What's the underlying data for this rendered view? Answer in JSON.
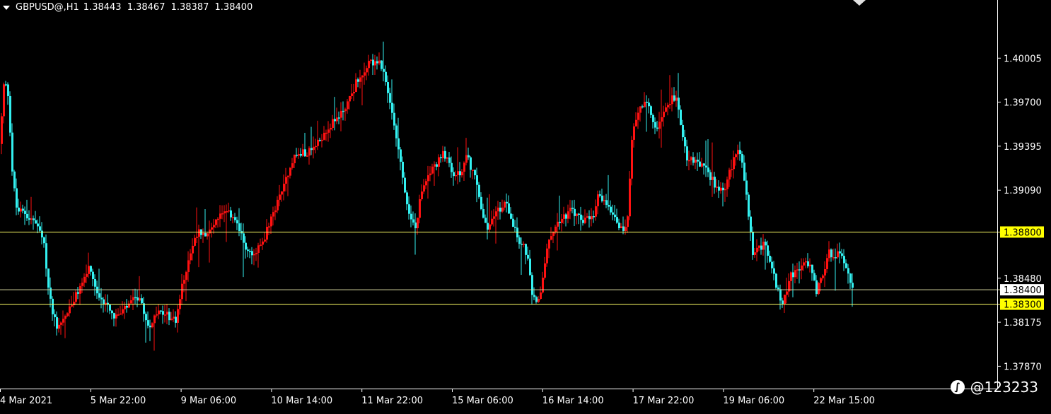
{
  "header": {
    "symbol": "GBPUSD@,H1",
    "open": "1.38443",
    "high": "1.38467",
    "low": "1.38387",
    "close": "1.38400"
  },
  "watermark": "@123233",
  "colors": {
    "background": "#000000",
    "bull": "#ff1111",
    "bear": "#33f0f0",
    "level_line": "#ffff66",
    "price_line": "#d8d8a0",
    "label_bg": "#ffff00",
    "price_label_bg": "#ffffff",
    "axis_text": "#ffffff"
  },
  "chart_data": {
    "type": "candlestick",
    "symbol": "GBPUSD",
    "timeframe": "H1",
    "ylim": [
      1.3773,
      1.4031
    ],
    "y_ticks": [
      "1.40005",
      "1.39700",
      "1.39395",
      "1.39090",
      "1.38480",
      "1.38175",
      "1.37870"
    ],
    "x_ticks": [
      "4 Mar 2021",
      "5 Mar 22:00",
      "9 Mar 06:00",
      "10 Mar 14:00",
      "11 Mar 22:00",
      "15 Mar 06:00",
      "16 Mar 14:00",
      "17 Mar 22:00",
      "19 Mar 06:00",
      "22 Mar 15:00"
    ],
    "levels": [
      {
        "label": "1.38800",
        "value": 1.388
      },
      {
        "label": "1.38300",
        "value": 1.383
      }
    ],
    "current_price": {
      "label": "1.38400",
      "value": 1.384
    },
    "anchors": [
      {
        "x": 0,
        "y": 1.3941
      },
      {
        "x": 6,
        "y": 1.3985
      },
      {
        "x": 12,
        "y": 1.3975
      },
      {
        "x": 18,
        "y": 1.3918
      },
      {
        "x": 24,
        "y": 1.3895
      },
      {
        "x": 36,
        "y": 1.3893
      },
      {
        "x": 52,
        "y": 1.3885
      },
      {
        "x": 62,
        "y": 1.3872
      },
      {
        "x": 70,
        "y": 1.3835
      },
      {
        "x": 80,
        "y": 1.3815
      },
      {
        "x": 90,
        "y": 1.382
      },
      {
        "x": 100,
        "y": 1.3828
      },
      {
        "x": 114,
        "y": 1.3842
      },
      {
        "x": 125,
        "y": 1.3855
      },
      {
        "x": 140,
        "y": 1.3832
      },
      {
        "x": 152,
        "y": 1.3832
      },
      {
        "x": 160,
        "y": 1.3822
      },
      {
        "x": 168,
        "y": 1.3822
      },
      {
        "x": 180,
        "y": 1.3828
      },
      {
        "x": 195,
        "y": 1.3835
      },
      {
        "x": 210,
        "y": 1.3815
      },
      {
        "x": 225,
        "y": 1.3824
      },
      {
        "x": 238,
        "y": 1.3822
      },
      {
        "x": 248,
        "y": 1.3818
      },
      {
        "x": 256,
        "y": 1.3838
      },
      {
        "x": 268,
        "y": 1.3865
      },
      {
        "x": 280,
        "y": 1.388
      },
      {
        "x": 295,
        "y": 1.388
      },
      {
        "x": 310,
        "y": 1.3892
      },
      {
        "x": 330,
        "y": 1.3892
      },
      {
        "x": 345,
        "y": 1.3872
      },
      {
        "x": 358,
        "y": 1.3862
      },
      {
        "x": 370,
        "y": 1.3872
      },
      {
        "x": 385,
        "y": 1.389
      },
      {
        "x": 400,
        "y": 1.3912
      },
      {
        "x": 415,
        "y": 1.3932
      },
      {
        "x": 430,
        "y": 1.3935
      },
      {
        "x": 445,
        "y": 1.3938
      },
      {
        "x": 460,
        "y": 1.395
      },
      {
        "x": 475,
        "y": 1.3958
      },
      {
        "x": 490,
        "y": 1.3968
      },
      {
        "x": 505,
        "y": 1.3985
      },
      {
        "x": 515,
        "y": 1.3992
      },
      {
        "x": 525,
        "y": 1.3998
      },
      {
        "x": 535,
        "y": 1.3998
      },
      {
        "x": 545,
        "y": 1.3985
      },
      {
        "x": 555,
        "y": 1.396
      },
      {
        "x": 563,
        "y": 1.3942
      },
      {
        "x": 572,
        "y": 1.3908
      },
      {
        "x": 580,
        "y": 1.389
      },
      {
        "x": 588,
        "y": 1.3883
      },
      {
        "x": 595,
        "y": 1.3905
      },
      {
        "x": 605,
        "y": 1.3922
      },
      {
        "x": 615,
        "y": 1.3925
      },
      {
        "x": 628,
        "y": 1.3935
      },
      {
        "x": 640,
        "y": 1.392
      },
      {
        "x": 650,
        "y": 1.392
      },
      {
        "x": 660,
        "y": 1.3932
      },
      {
        "x": 672,
        "y": 1.3918
      },
      {
        "x": 682,
        "y": 1.3892
      },
      {
        "x": 688,
        "y": 1.3882
      },
      {
        "x": 700,
        "y": 1.3892
      },
      {
        "x": 715,
        "y": 1.39
      },
      {
        "x": 722,
        "y": 1.3893
      },
      {
        "x": 730,
        "y": 1.3878
      },
      {
        "x": 745,
        "y": 1.3865
      },
      {
        "x": 752,
        "y": 1.3838
      },
      {
        "x": 758,
        "y": 1.3828
      },
      {
        "x": 765,
        "y": 1.384
      },
      {
        "x": 772,
        "y": 1.3865
      },
      {
        "x": 782,
        "y": 1.3882
      },
      {
        "x": 795,
        "y": 1.389
      },
      {
        "x": 808,
        "y": 1.3895
      },
      {
        "x": 818,
        "y": 1.389
      },
      {
        "x": 828,
        "y": 1.3888
      },
      {
        "x": 838,
        "y": 1.3888
      },
      {
        "x": 846,
        "y": 1.3905
      },
      {
        "x": 858,
        "y": 1.39
      },
      {
        "x": 868,
        "y": 1.3893
      },
      {
        "x": 880,
        "y": 1.388
      },
      {
        "x": 888,
        "y": 1.389
      },
      {
        "x": 893,
        "y": 1.394
      },
      {
        "x": 900,
        "y": 1.3962
      },
      {
        "x": 912,
        "y": 1.3972
      },
      {
        "x": 922,
        "y": 1.3958
      },
      {
        "x": 930,
        "y": 1.395
      },
      {
        "x": 940,
        "y": 1.3968
      },
      {
        "x": 950,
        "y": 1.3972
      },
      {
        "x": 958,
        "y": 1.397
      },
      {
        "x": 965,
        "y": 1.395
      },
      {
        "x": 972,
        "y": 1.393
      },
      {
        "x": 985,
        "y": 1.3928
      },
      {
        "x": 995,
        "y": 1.3925
      },
      {
        "x": 1005,
        "y": 1.3918
      },
      {
        "x": 1015,
        "y": 1.391
      },
      {
        "x": 1025,
        "y": 1.3912
      },
      {
        "x": 1035,
        "y": 1.3925
      },
      {
        "x": 1042,
        "y": 1.394
      },
      {
        "x": 1050,
        "y": 1.3925
      },
      {
        "x": 1058,
        "y": 1.3895
      },
      {
        "x": 1065,
        "y": 1.3862
      },
      {
        "x": 1072,
        "y": 1.3868
      },
      {
        "x": 1080,
        "y": 1.3872
      },
      {
        "x": 1090,
        "y": 1.3858
      },
      {
        "x": 1100,
        "y": 1.3838
      },
      {
        "x": 1108,
        "y": 1.383
      },
      {
        "x": 1115,
        "y": 1.3848
      },
      {
        "x": 1125,
        "y": 1.3853
      },
      {
        "x": 1135,
        "y": 1.3858
      },
      {
        "x": 1145,
        "y": 1.3858
      },
      {
        "x": 1155,
        "y": 1.3838
      },
      {
        "x": 1162,
        "y": 1.385
      },
      {
        "x": 1172,
        "y": 1.3865
      },
      {
        "x": 1185,
        "y": 1.3865
      },
      {
        "x": 1195,
        "y": 1.386
      },
      {
        "x": 1206,
        "y": 1.3842
      }
    ]
  }
}
